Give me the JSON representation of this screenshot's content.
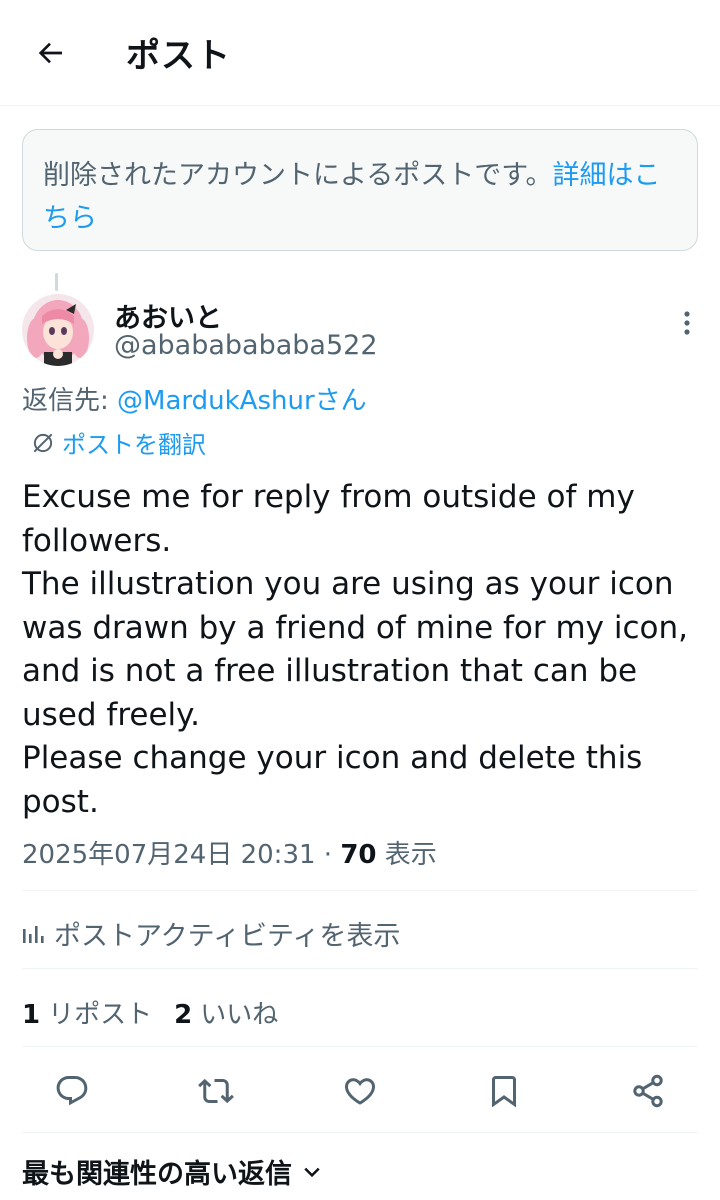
{
  "header": {
    "back_icon": "arrow-left-icon",
    "title": "ポスト"
  },
  "notice": {
    "text": "削除されたアカウントによるポストです。",
    "link_label": "詳細はこちら"
  },
  "post": {
    "author": {
      "display_name": "あおいと",
      "handle": "@abababababa522"
    },
    "reply_to": {
      "prefix": "返信先: ",
      "mention": "@MardukAshur",
      "suffix": "さん"
    },
    "translate_label": "ポストを翻訳",
    "body": "Excuse me for reply from outside of my followers.\nThe illustration you are using as your icon was drawn by a friend of mine for my icon, and is not a free illustration that can be used freely.\nPlease change your icon and delete this post.",
    "timestamp": "2025年07月24日 20:31",
    "separator": " · ",
    "views_count": "70",
    "views_label": " 表示",
    "activity_label": "ポストアクティビティを表示",
    "stats": {
      "reposts_count": "1",
      "reposts_label": "リポスト",
      "likes_count": "2",
      "likes_label": "いいね"
    }
  },
  "actions": [
    "reply-icon",
    "repost-icon",
    "like-icon",
    "bookmark-icon",
    "share-icon"
  ],
  "replies_sort": {
    "label": "最も関連性の高い返信"
  },
  "colors": {
    "accent": "#1d9bf0",
    "secondary_text": "#536471",
    "primary_text": "#0f1419",
    "border": "#eff3f4"
  }
}
